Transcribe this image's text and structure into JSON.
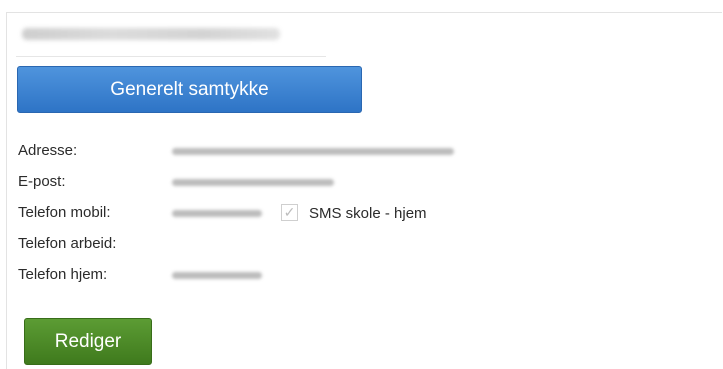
{
  "profile": {
    "name_hidden": true
  },
  "consent": {
    "button_label": "Generelt samtykke"
  },
  "contact": {
    "address_label": "Adresse:",
    "email_label": "E-post:",
    "mobile_label": "Telefon mobil:",
    "work_label": "Telefon arbeid:",
    "home_label": "Telefon hjem:",
    "sms_label": "SMS skole - hjem",
    "sms_checkbox_icon": "check-icon"
  },
  "actions": {
    "edit_label": "Rediger"
  },
  "colors": {
    "primary_button": "#3a80d0",
    "edit_button": "#4f8a2a"
  }
}
